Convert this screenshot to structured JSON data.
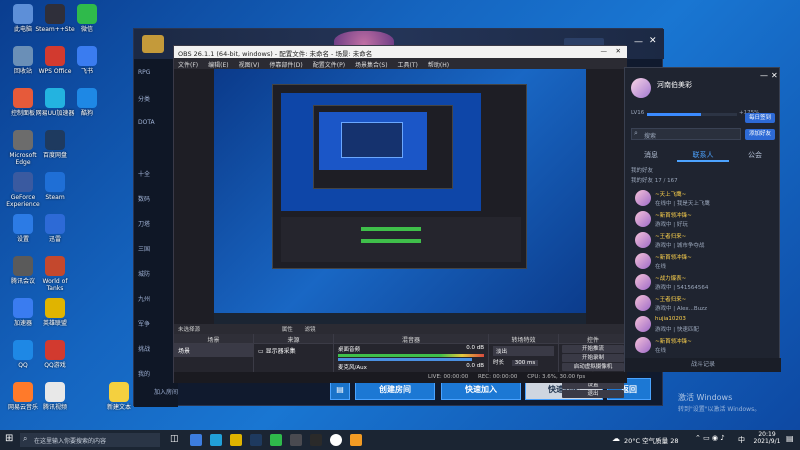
{
  "desktop": {
    "icons": [
      {
        "label": "此电脑",
        "x": 0,
        "y": 0
      },
      {
        "label": "Steam++Ste",
        "x": 1,
        "y": 0
      },
      {
        "label": "微信",
        "x": 2,
        "y": 0
      },
      {
        "label": "回收站",
        "x": 0,
        "y": 1
      },
      {
        "label": "WPS Office",
        "x": 1,
        "y": 1
      },
      {
        "label": "飞书",
        "x": 2,
        "y": 1
      },
      {
        "label": "控制面板",
        "x": 0,
        "y": 2
      },
      {
        "label": "网易UU加速器",
        "x": 1,
        "y": 2
      },
      {
        "label": "酷狗",
        "x": 2,
        "y": 2
      },
      {
        "label": "Microsoft Edge",
        "x": 0,
        "y": 3
      },
      {
        "label": "百度网盘",
        "x": 1,
        "y": 3
      },
      {
        "label": "GeForce Experience",
        "x": 0,
        "y": 4
      },
      {
        "label": "Steam",
        "x": 1,
        "y": 4
      },
      {
        "label": "设置",
        "x": 0,
        "y": 5
      },
      {
        "label": "迅雷",
        "x": 1,
        "y": 5
      },
      {
        "label": "腾讯会议",
        "x": 0,
        "y": 6
      },
      {
        "label": "World of Tanks",
        "x": 1,
        "y": 6
      },
      {
        "label": "加速器",
        "x": 0,
        "y": 7
      },
      {
        "label": "英雄联盟",
        "x": 1,
        "y": 7
      },
      {
        "label": "QQ",
        "x": 0,
        "y": 8
      },
      {
        "label": "QQ游戏",
        "x": 1,
        "y": 8
      },
      {
        "label": "网易云音乐",
        "x": 0,
        "y": 9
      },
      {
        "label": "腾讯视频",
        "x": 1,
        "y": 9
      },
      {
        "label": "新建文本",
        "x": 3,
        "y": 9
      }
    ]
  },
  "game": {
    "sidebar": [
      "RPG",
      "分类",
      "DOTA",
      "",
      "十全",
      "数码",
      "刀塔",
      "三国",
      "城防",
      "九州",
      "军争",
      "挑战",
      "我的"
    ],
    "bottom_buttons": {
      "create": "创建房间",
      "quick_join": "快速加入",
      "quick_match": "快速匹配",
      "back": "返回"
    },
    "join_room": "加入房间"
  },
  "obs": {
    "title": "OBS 26.1.1 (64-bit, windows) - 配置文件: 未命名 - 场景: 未命名",
    "menu": [
      "文件(F)",
      "编辑(E)",
      "视图(V)",
      "停靠部件(D)",
      "配置文件(P)",
      "场景集合(S)",
      "工具(T)",
      "帮助(H)"
    ],
    "status_source": "未选择源",
    "status_props": "属性",
    "status_filters": "滤镜",
    "docks": {
      "scenes": "场景",
      "sources": "来源",
      "mixer": "混音器",
      "transitions": "转场特效",
      "controls": "控件"
    },
    "scene_item": "场景",
    "source_item": "显示器采集",
    "mixer": {
      "desktop": "桌面音频",
      "desktop_db": "0.0 dB",
      "mic": "麦克风/Aux",
      "mic_db": "0.0 dB"
    },
    "transition": {
      "type": "淡出",
      "duration_label": "时长",
      "duration": "300 ms"
    },
    "controls": [
      "开始推流",
      "开始录制",
      "启动虚拟摄像机",
      "工作室模式",
      "设置",
      "退出"
    ],
    "statusbar": {
      "live": "LIVE: 00:00:00",
      "rec": "REC: 00:00:00",
      "cpu": "CPU: 3.6%, 30.00 fps"
    }
  },
  "chat": {
    "username": "河南伯美彩",
    "level": "LV16",
    "progress_pct": "+175%",
    "btn_guard": "每日签到",
    "btn_add": "添加好友",
    "search_placeholder": "搜索",
    "tabs": [
      "消息",
      "联系人",
      "公会"
    ],
    "active_tab": 1,
    "groups": [
      "我的好友",
      "我的好友 17 / 167"
    ],
    "contacts": [
      {
        "name": "~天上飞鹰~",
        "status": "在线中 | 我是天上飞鹰"
      },
      {
        "name": "~新首领冲锋~",
        "status": "游戏中 | 好玩"
      },
      {
        "name": "~王者归来~",
        "status": "游戏中 | 城市争夺战"
      },
      {
        "name": "~新首领冲锋~",
        "status": "在线"
      },
      {
        "name": "~战力爆表~",
        "status": "游戏中 | 541564564"
      },
      {
        "name": "~王者归来~",
        "status": "游戏中 | Alex...Buzz"
      },
      {
        "name": "hujia10203",
        "status": "游戏中 | 快速匹配"
      },
      {
        "name": "~新首领冲锋~",
        "status": "在线"
      }
    ],
    "footer": "战斗记录"
  },
  "watermark": {
    "line1": "激活 Windows",
    "line2": "转到\"设置\"以激活 Windows。"
  },
  "taskbar": {
    "search_placeholder": "在这里输入你要搜索的内容",
    "weather": "20°C 空气质量 28",
    "time": "20:19",
    "date": "2021/9/1",
    "lang": "中"
  }
}
